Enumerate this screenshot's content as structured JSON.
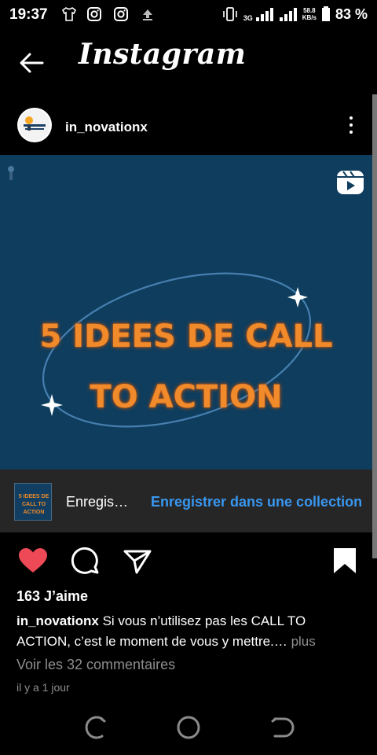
{
  "status_bar": {
    "time": "19:37",
    "network": "3G",
    "speed_value": "58.8",
    "speed_unit": "KB/s",
    "battery": "83 %"
  },
  "header": {
    "title": "Instagram"
  },
  "post": {
    "username": "in_novationx",
    "media_title_line1": "5 IDEES DE CALL",
    "media_title_line2": "TO ACTION"
  },
  "save_bar": {
    "thumb_text": "5 IDEES DE CALL TO ACTION",
    "label": "Enregis…",
    "collection_link": "Enregistrer dans une collection"
  },
  "actions": {
    "liked": true,
    "saved": true
  },
  "likes": "163 J’aime",
  "caption": {
    "user": "in_novationx",
    "text": "Si vous n’utilisez pas les CALL TO ACTION, c’est le moment de vous y mettre.…",
    "more": "plus"
  },
  "view_comments": "Voir les 32 commentaires",
  "time_ago": "il y a 1 jour",
  "colors": {
    "like_red": "#ed4956",
    "link_blue": "#3897f0",
    "media_bg": "#0e3d5e",
    "media_text": "#f08a2a"
  },
  "icons": {
    "status": [
      "tshirt-icon",
      "instagram-icon",
      "instagram-icon",
      "upload-icon",
      "vibrate-icon",
      "signal-icon",
      "battery-icon"
    ],
    "header": [
      "back-arrow-icon"
    ],
    "post": [
      "more-vertical-icon",
      "reels-icon",
      "heart-icon",
      "comment-icon",
      "share-icon",
      "bookmark-icon"
    ],
    "nav": [
      "recents-icon",
      "home-icon",
      "back-icon"
    ]
  }
}
